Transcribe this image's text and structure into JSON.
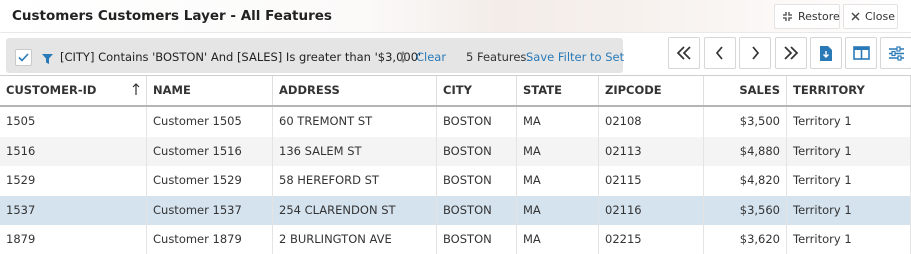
{
  "window": {
    "title": "Customers Customers Layer - All Features",
    "restore_label": "Restore",
    "close_label": "Close"
  },
  "filter": {
    "expression": "[CITY] Contains 'BOSTON' And [SALES] Is greater than '$3,000'",
    "clear_label": "Clear",
    "count_text": "5 Features.",
    "save_label": "Save Filter to Set",
    "enabled": true
  },
  "toolbar": {
    "icons": [
      "first-page-icon",
      "previous-page-icon",
      "next-page-icon",
      "last-page-icon",
      "export-icon",
      "columns-icon",
      "settings-sliders-icon"
    ]
  },
  "table": {
    "columns": [
      "CUSTOMER-ID",
      "NAME",
      "ADDRESS",
      "CITY",
      "STATE",
      "ZIPCODE",
      "SALES",
      "TERRITORY"
    ],
    "sorted_column": "CUSTOMER-ID",
    "sort_direction": "ascending",
    "selected_row": 3,
    "rows": [
      [
        "1505",
        "Customer 1505",
        "60 TREMONT ST",
        "BOSTON",
        "MA",
        "02108",
        "$3,500",
        "Territory 1"
      ],
      [
        "1516",
        "Customer 1516",
        "136 SALEM ST",
        "BOSTON",
        "MA",
        "02113",
        "$4,880",
        "Territory 1"
      ],
      [
        "1529",
        "Customer 1529",
        "58 HEREFORD ST",
        "BOSTON",
        "MA",
        "02115",
        "$4,820",
        "Territory 1"
      ],
      [
        "1537",
        "Customer 1537",
        "254 CLARENDON ST",
        "BOSTON",
        "MA",
        "02116",
        "$3,560",
        "Territory 1"
      ],
      [
        "1879",
        "Customer 1879",
        "2 BURLINGTON AVE",
        "BOSTON",
        "MA",
        "02215",
        "$3,620",
        "Territory 1"
      ]
    ]
  },
  "colors": {
    "accent": "#2a7ab8",
    "selected_row": "#d5e3ef",
    "alt_row": "#f4f4f4",
    "filter_bar": "#e5e5e5"
  }
}
